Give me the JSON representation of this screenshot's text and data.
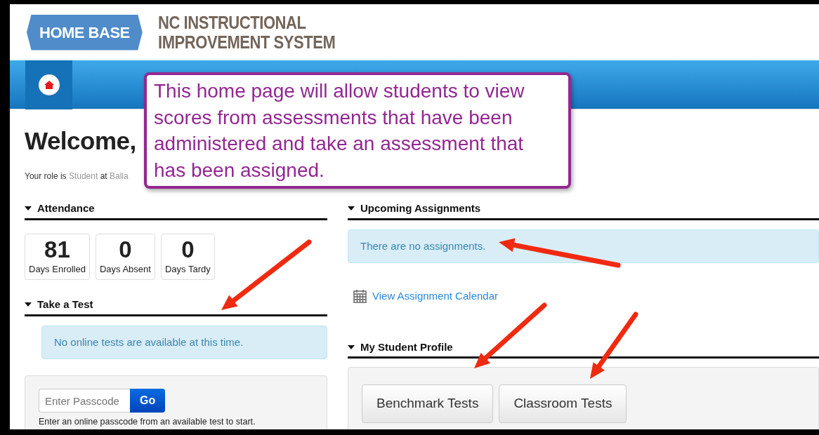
{
  "header": {
    "logo_text": "HOME BASE",
    "system_name": [
      "NC INSTRUCTIONAL",
      "IMPROVEMENT SYSTEM"
    ]
  },
  "navbar": {
    "items": [
      {
        "kind": "home",
        "selected": true
      }
    ]
  },
  "welcome": {
    "heading": "Welcome,",
    "role_line": [
      {
        "text": "Your role is",
        "kind": "plain"
      },
      {
        "text": "Student",
        "kind": "muted"
      },
      {
        "text": "at",
        "kind": "plain"
      },
      {
        "text": "Balla",
        "kind": "muted"
      }
    ]
  },
  "left": {
    "attendance": {
      "title": "Attendance",
      "expanded": true,
      "stats": [
        {
          "value": "81",
          "label": "Days Enrolled"
        },
        {
          "value": "0",
          "label": "Days Absent"
        },
        {
          "value": "0",
          "label": "Days Tardy"
        }
      ]
    },
    "take_a_test": {
      "title": "Take a Test",
      "expanded": true,
      "message": "No online tests are available at this time.",
      "passcode": {
        "placeholder": "Enter Passcode",
        "button": "Go",
        "help": "Enter an online passcode from an available test to start."
      }
    }
  },
  "right": {
    "upcoming_assignments": {
      "title": "Upcoming Assignments",
      "expanded": true,
      "message": "There are no assignments.",
      "link": "View Assignment Calendar"
    },
    "my_student_profile": {
      "title": "My Student Profile",
      "expanded": true,
      "buttons": [
        "Benchmark Tests",
        "Classroom Tests"
      ]
    }
  },
  "callout": {
    "text": "This home page will allow students to view scores from assessments that have been administered and take an assessment that has been assigned."
  }
}
